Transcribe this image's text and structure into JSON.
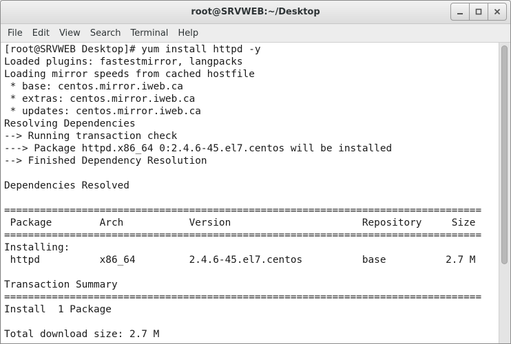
{
  "window": {
    "title": "root@SRVWEB:~/Desktop"
  },
  "menu": [
    "File",
    "Edit",
    "View",
    "Search",
    "Terminal",
    "Help"
  ],
  "terminal": {
    "lines": [
      "[root@SRVWEB Desktop]# yum install httpd -y",
      "Loaded plugins: fastestmirror, langpacks",
      "Loading mirror speeds from cached hostfile",
      " * base: centos.mirror.iweb.ca",
      " * extras: centos.mirror.iweb.ca",
      " * updates: centos.mirror.iweb.ca",
      "Resolving Dependencies",
      "--> Running transaction check",
      "---> Package httpd.x86_64 0:2.4.6-45.el7.centos will be installed",
      "--> Finished Dependency Resolution",
      "",
      "Dependencies Resolved",
      "",
      "================================================================================",
      " Package        Arch           Version                      Repository     Size",
      "================================================================================",
      "Installing:",
      " httpd          x86_64         2.4.6-45.el7.centos          base          2.7 M",
      "",
      "Transaction Summary",
      "================================================================================",
      "Install  1 Package",
      "",
      "Total download size: 2.7 M"
    ]
  },
  "icons": {
    "minimize": "minimize-icon",
    "maximize": "maximize-icon",
    "close": "close-icon"
  }
}
